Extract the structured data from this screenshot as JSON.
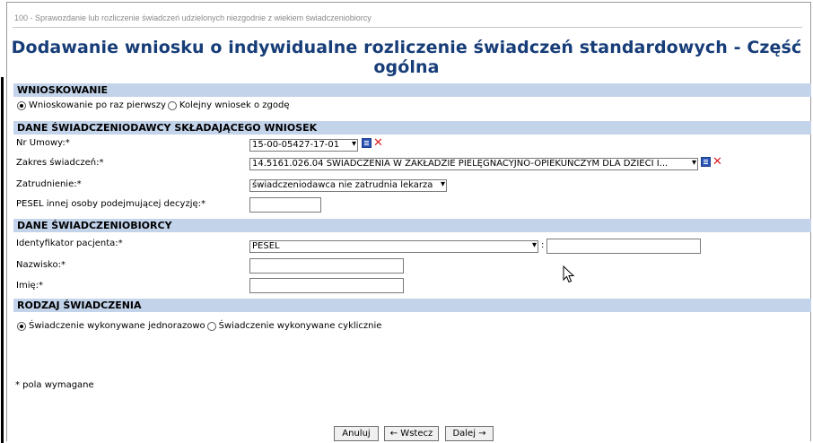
{
  "breadcrumb": "100 - Sprawozdanie lub rozliczenie świadczeń udzielonych niezgodnie z wiekiem świadczeniobiorcy",
  "page_title": "Dodawanie wniosku o indywidualne rozliczenie świadczeń standardowych - Część ogólna",
  "sections": {
    "wnioskowanie": {
      "title": "WNIOSKOWANIE",
      "option_first": "Wnioskowanie po raz pierwszy",
      "option_next": "Kolejny wniosek o zgodę",
      "selected": "first"
    },
    "provider": {
      "title": "DANE ŚWIADCZENIODAWCY SKŁADAJĄCEGO WNIOSEK",
      "contract_label": "Nr Umowy:*",
      "contract_value": "15-00-05427-17-01",
      "scope_label": "Zakres świadczeń:*",
      "scope_value": "14.5161.026.04 ŚWIADCZENIA W ZAKŁADZIE PIELĘGNACYJNO-OPIEKUŃCZYM DLA DZIECI I...",
      "employment_label": "Zatrudnienie:*",
      "employment_value": "świadczeniodawca nie zatrudnia lekarza",
      "pesel_other_label": "PESEL innej osoby podejmującej decyzję:*",
      "pesel_other_value": ""
    },
    "patient": {
      "title": "DANE ŚWIADCZENIOBIORCY",
      "id_label": "Identyfikator pacjenta:*",
      "id_type_value": "PESEL",
      "id_value": "",
      "surname_label": "Nazwisko:*",
      "surname_value": "",
      "name_label": "Imię:*",
      "name_value": ""
    },
    "service_type": {
      "title": "RODZAJ ŚWIADCZENIA",
      "option_single": "Świadczenie wykonywane jednorazowo",
      "option_cyclic": "Świadczenie wykonywane cyklicznie",
      "selected": "single"
    }
  },
  "footnote": "* pola wymagane",
  "buttons": {
    "cancel": "Anuluj",
    "back": "← Wstecz",
    "next": "Dalej →"
  },
  "colors": {
    "title": "#173d78",
    "section_bg": "#c2d3ea",
    "delete_icon": "#e02020",
    "list_icon": "#2b55b5"
  }
}
